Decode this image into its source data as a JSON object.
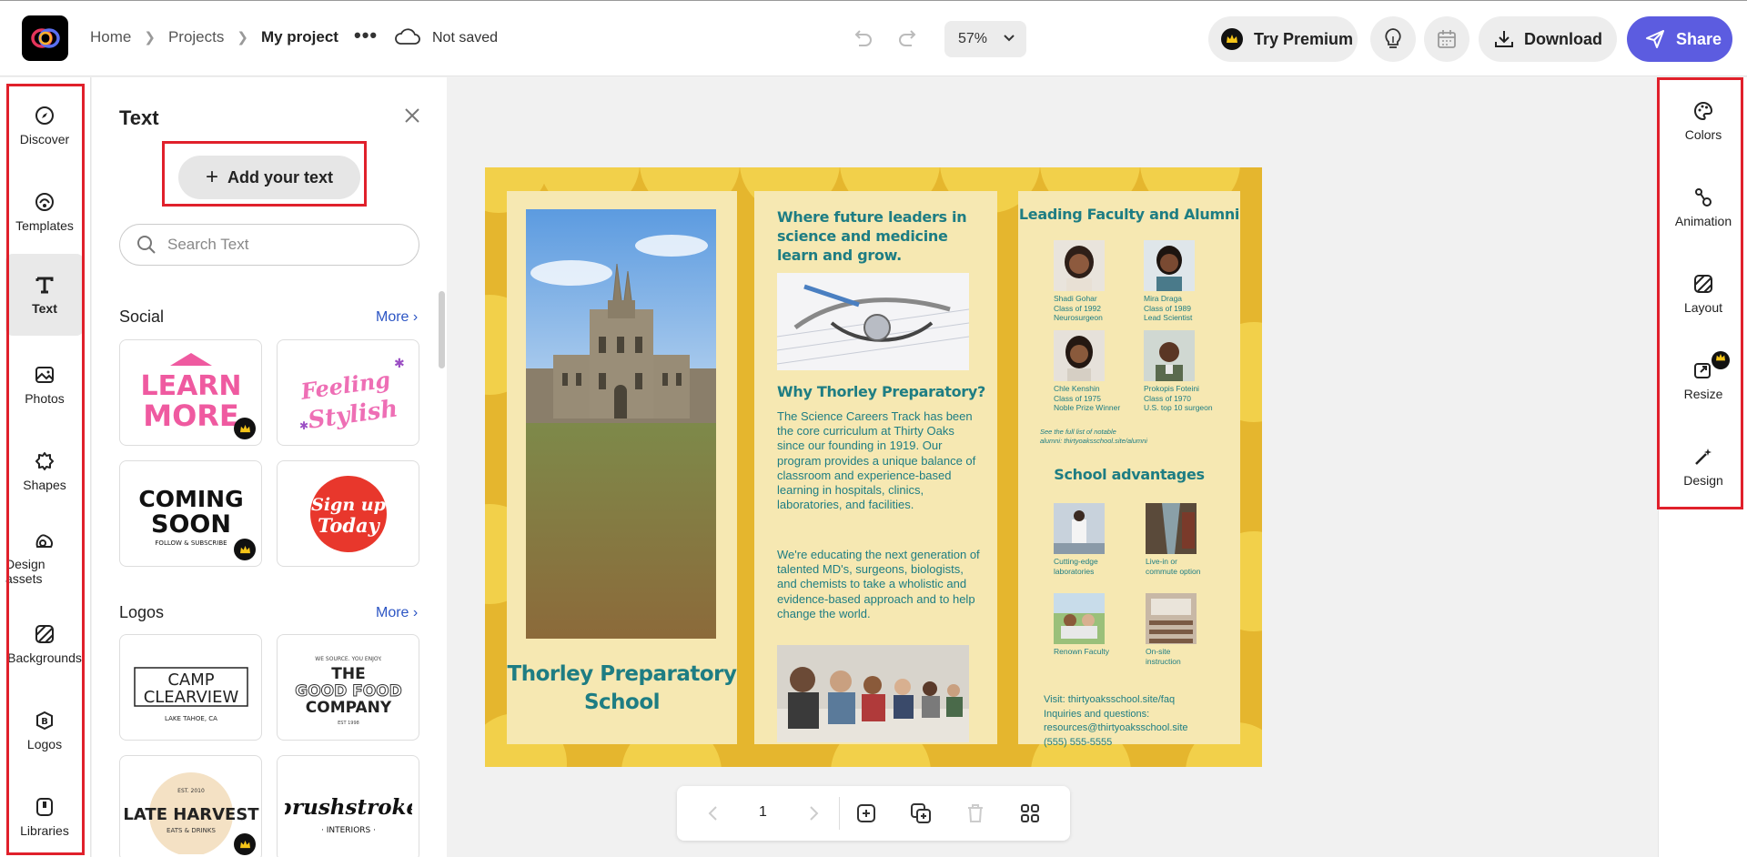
{
  "breadcrumb": {
    "home": "Home",
    "projects": "Projects",
    "current": "My project"
  },
  "header": {
    "more": "•••",
    "save_status": "Not saved",
    "zoom": "57%",
    "premium_label": "Try Premium",
    "download_label": "Download",
    "share_label": "Share",
    "accent_color": "#5c5ce0"
  },
  "left_rail": {
    "items": [
      {
        "label": "Discover",
        "icon": "compass-icon"
      },
      {
        "label": "Templates",
        "icon": "templates-icon"
      },
      {
        "label": "Text",
        "icon": "text-icon"
      },
      {
        "label": "Photos",
        "icon": "photo-icon"
      },
      {
        "label": "Shapes",
        "icon": "shapes-icon"
      },
      {
        "label": "Design assets",
        "icon": "design-assets-icon"
      },
      {
        "label": "Backgrounds",
        "icon": "backgrounds-icon"
      },
      {
        "label": "Logos",
        "icon": "logos-icon"
      },
      {
        "label": "Libraries",
        "icon": "libraries-icon"
      }
    ]
  },
  "panel": {
    "title": "Text",
    "add_text": "Add your text",
    "search_placeholder": "Search Text",
    "social": {
      "heading": "Social",
      "more": "More"
    },
    "logos": {
      "heading": "Logos",
      "more": "More"
    },
    "social_cards": [
      {
        "line1": "LEARN",
        "line2": "MORE",
        "premium": true
      },
      {
        "line1": "Feeling",
        "line2": "Stylish",
        "premium": false
      },
      {
        "line1": "COMING",
        "line2": "SOON",
        "sub": "FOLLOW & SUBSCRIBE",
        "premium": true
      },
      {
        "line1": "Sign up",
        "line2": "Today",
        "premium": false
      }
    ],
    "logo_cards": [
      {
        "line1": "CAMP",
        "line2": "CLEARVIEW",
        "sub": "LAKE TAHOE, CA",
        "premium": false
      },
      {
        "top": "WE SOURCE. YOU ENJOY.",
        "line1": "THE",
        "line2": "GOOD FOOD",
        "line3": "COMPANY",
        "sub": "EST 1998",
        "premium": false
      },
      {
        "top": "EST. 2010",
        "line1": "LATE HARVEST",
        "sub": "EATS & DRINKS",
        "premium": true
      },
      {
        "line1": "brushstroke",
        "sub": "· INTERIORS ·",
        "premium": false
      }
    ]
  },
  "brochure": {
    "school_name_1": "Thorley Preparatory",
    "school_name_2": "School",
    "col2": {
      "headline_1": "Where future leaders in",
      "headline_2": "science and medicine",
      "headline_3": "learn and grow.",
      "why_heading": "Why Thorley Preparatory?",
      "para1": "The Science Careers Track has been the core curriculum at Thirty Oaks since our founding in 1919. Our program provides a unique balance of classroom and experience-based learning in hospitals, clinics, laboratories, and facilities.",
      "para2": "We're educating the next generation of talented MD's, surgeons, biologists, and chemists to take a wholistic and evidence-based approach and to help change the world."
    },
    "col3": {
      "faculty_heading": "Leading Faculty and Alumni",
      "people": [
        {
          "name": "Shadi Gohar",
          "class": "Class of 1992",
          "role": "Neurosurgeon"
        },
        {
          "name": "Mira Draga",
          "class": "Class of 1989",
          "role": "Lead Scientist"
        },
        {
          "name": "Chle Kenshin",
          "class": "Class of 1975",
          "role": "Noble Prize Winner"
        },
        {
          "name": "Prokopis Foteini",
          "class": "Class of 1970",
          "role": "U.S. top 10 surgeon"
        }
      ],
      "note_1": "See the full list of notable",
      "note_2": "alumni: thirtyoaksschool.site/alumni",
      "advantages_heading": "School advantages",
      "advantages": [
        {
          "line1": "Cutting-edge",
          "line2": "laboratories"
        },
        {
          "line1": "Live-in or",
          "line2": "commute option"
        },
        {
          "line1": "Renown Faculty",
          "line2": ""
        },
        {
          "line1": "On-site",
          "line2": "instruction"
        }
      ],
      "contact_1": "Visit: thirtyoaksschool.site/faq",
      "contact_2": "Inquiries and questions:",
      "contact_3": "resources@thirtyoaksschool.site",
      "contact_4": "(555) 555-5555"
    }
  },
  "page_controls": {
    "page": "1"
  },
  "right_rail": {
    "items": [
      {
        "label": "Colors",
        "icon": "palette-icon"
      },
      {
        "label": "Animation",
        "icon": "animation-icon"
      },
      {
        "label": "Layout",
        "icon": "layout-icon"
      },
      {
        "label": "Resize",
        "icon": "resize-icon"
      },
      {
        "label": "Design",
        "icon": "magic-wand-icon"
      }
    ]
  }
}
